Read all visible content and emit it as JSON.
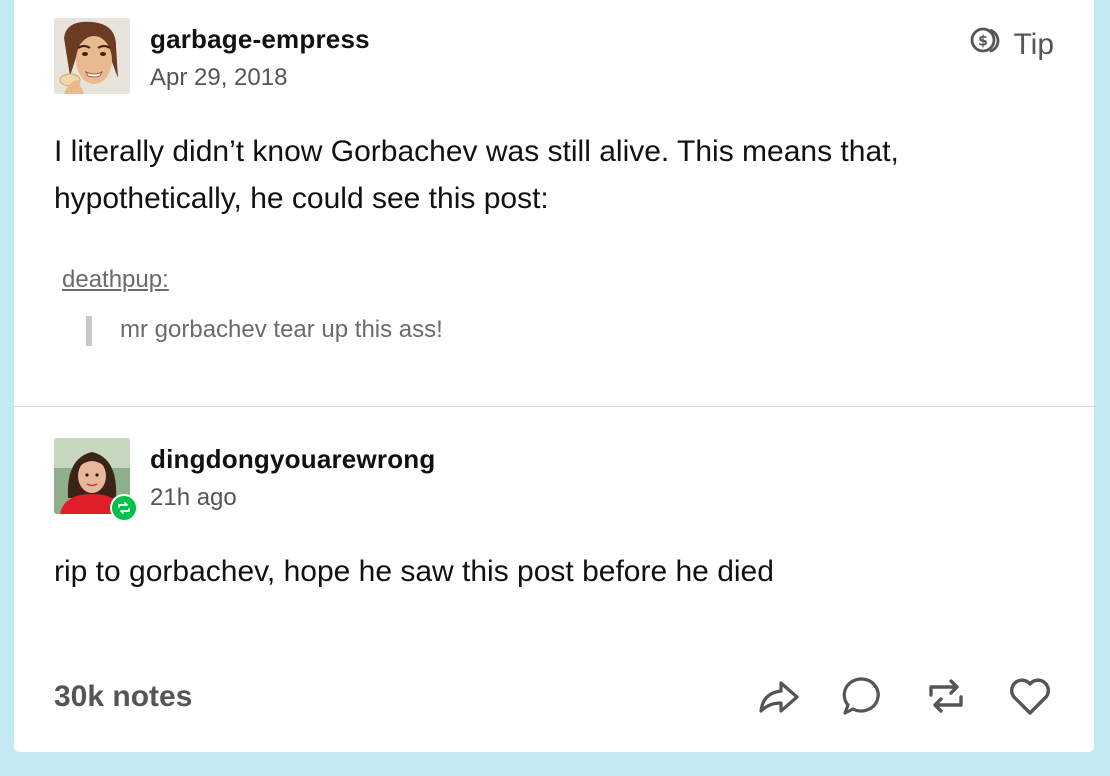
{
  "post": {
    "username": "garbage-empress",
    "timestamp": "Apr 29, 2018",
    "tip_label": "Tip",
    "body": "I literally didn’t know Gorbachev was still alive. This means that, hypothetically, he could see this post:",
    "quoted": {
      "username": "deathpup",
      "colon": ":",
      "text": "mr gorbachev tear up this ass!"
    }
  },
  "reblog": {
    "username": "dingdongyouarewrong",
    "timestamp": "21h ago",
    "body": "rip to gorbachev, hope he saw this post before he died"
  },
  "footer": {
    "notes": "30k notes"
  },
  "icons": {
    "tip": "tip-coin-icon",
    "share": "share-icon",
    "reply": "reply-icon",
    "reblog": "reblog-icon",
    "like": "heart-icon"
  },
  "colors": {
    "background": "#c3eaf2",
    "reblog_badge": "#00c24a"
  }
}
